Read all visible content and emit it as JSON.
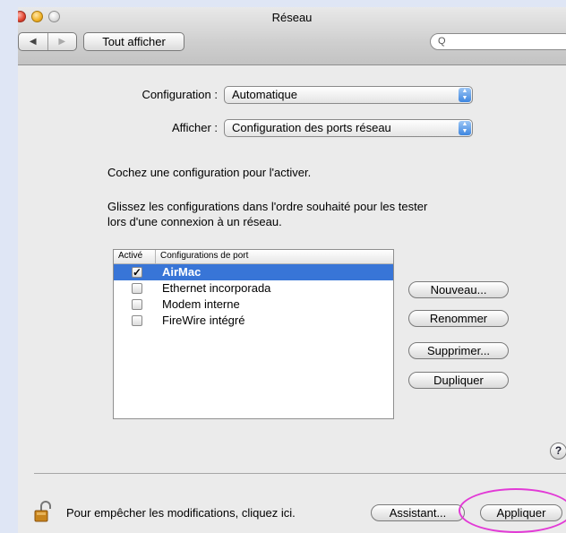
{
  "window": {
    "title": "Réseau",
    "show_all_label": "Tout afficher",
    "search_glyph": "Q",
    "nav_back": "◀",
    "nav_forward": "▶"
  },
  "form": {
    "configuration_label": "Configuration :",
    "configuration_value": "Automatique",
    "show_label": "Afficher :",
    "show_value": "Configuration des ports réseau"
  },
  "instructions": {
    "line1": "Cochez une configuration pour l'activer.",
    "line2": "Glissez les configurations dans l'ordre souhaité pour les tester",
    "line3": "lors d'une connexion à un réseau."
  },
  "port_list": {
    "col_active": "Activé",
    "col_config": "Configurations de port",
    "rows": [
      {
        "label": "AirMac",
        "checked": true,
        "selected": true
      },
      {
        "label": "Ethernet incorporada",
        "checked": false,
        "selected": false
      },
      {
        "label": "Modem interne",
        "checked": false,
        "selected": false
      },
      {
        "label": "FireWire intégré",
        "checked": false,
        "selected": false
      }
    ]
  },
  "side_buttons": {
    "new": "Nouveau...",
    "rename": "Renommer",
    "delete": "Supprimer...",
    "duplicate": "Dupliquer"
  },
  "help_label": "?",
  "footer": {
    "lock_text": "Pour empêcher les modifications, cliquez ici.",
    "assistant": "Assistant...",
    "apply": "Appliquer"
  },
  "colors": {
    "selection": "#3875d7",
    "highlight_ring": "#e23ad6",
    "background": "#dfe6f5"
  }
}
